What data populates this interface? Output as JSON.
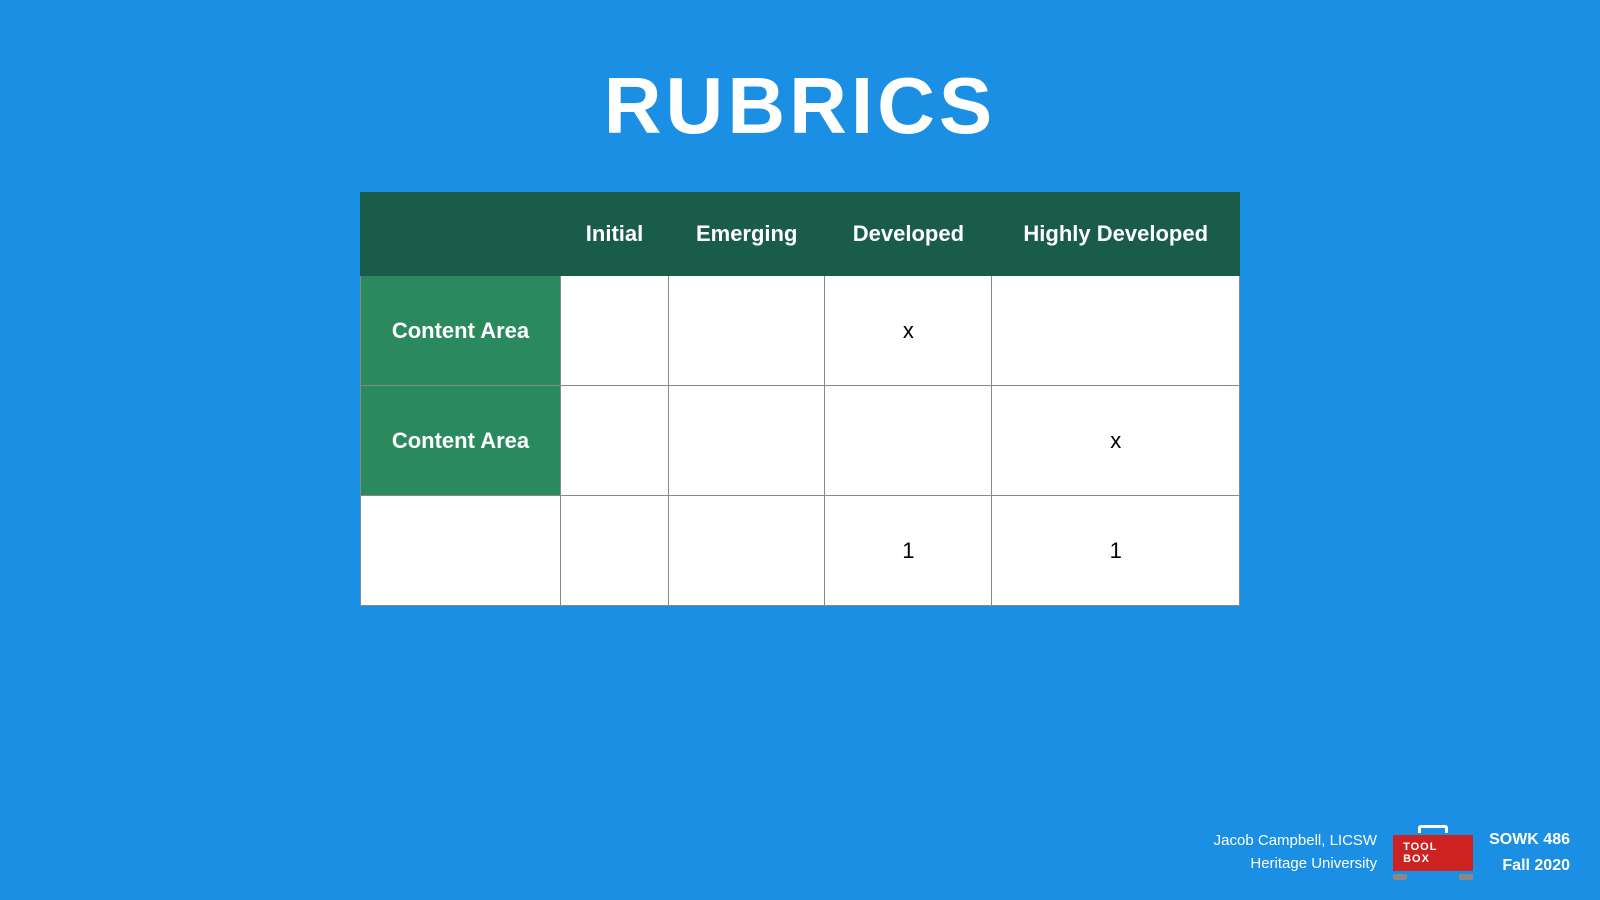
{
  "title": "RUBRICS",
  "table": {
    "headers": [
      "",
      "Initial",
      "Emerging",
      "Developed",
      "Highly Developed"
    ],
    "rows": [
      {
        "label": "Content Area",
        "cells": [
          "",
          "",
          "x",
          ""
        ]
      },
      {
        "label": "Content Area",
        "cells": [
          "",
          "",
          "",
          "x"
        ]
      },
      {
        "label": "",
        "cells": [
          "",
          "",
          "1",
          "1"
        ]
      }
    ]
  },
  "footer": {
    "instructor": "Jacob Campbell, LICSW",
    "institution": "Heritage University",
    "course": "SOWK 486",
    "term": "Fall 2020",
    "toolbox_label": "TOOL BOX"
  }
}
